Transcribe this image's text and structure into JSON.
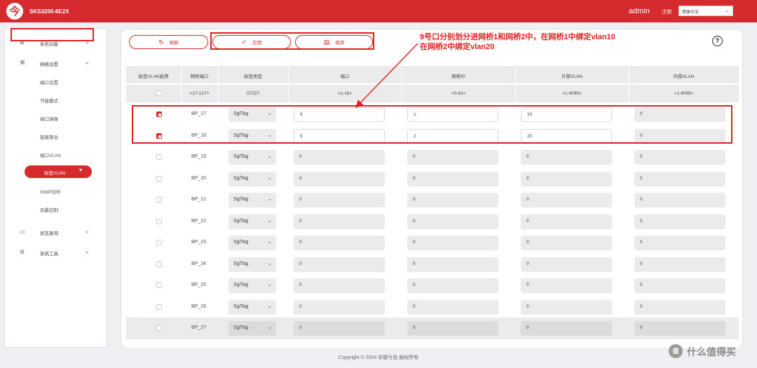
{
  "header": {
    "logo_char": "今",
    "model": "SKS3200-8E2X",
    "user": "admin",
    "logout": "注销",
    "language": "简体中文"
  },
  "sidebar": {
    "groups": [
      {
        "icon": "grid-icon",
        "label": "系统功能"
      },
      {
        "icon": "network-icon",
        "label": "网络设置"
      },
      {
        "icon": "monitor-icon",
        "label": "状态查询"
      },
      {
        "icon": "tools-icon",
        "label": "系统工具"
      }
    ],
    "sub_items": [
      "端口设置",
      "节能模式",
      "端口镜像",
      "链路聚合",
      "端口VLAN",
      "标签VLAN",
      "IGMP侦听",
      "风暴控制"
    ],
    "active_item": "标签VLAN"
  },
  "toolbar": {
    "refresh": "刷新",
    "apply": "应用",
    "save": "保存",
    "help": "?"
  },
  "annotation": {
    "line1": "9号口分别划分进网桥1和网桥2中，在网桥1中绑定vlan10",
    "line2": "在网桥2中绑定vlan20"
  },
  "table": {
    "headers": [
      "标签VLAN启用",
      "网桥端口",
      "标签类型",
      "端口",
      "网桥ID",
      "外部VLAN",
      "内部VLAN"
    ],
    "ranges": [
      "",
      "<17-127>",
      "ST/DT",
      "<1-16>",
      "<0-63>",
      "<1-4095>",
      "<1-4095>"
    ],
    "rows": [
      {
        "enabled": true,
        "port": "BP_17",
        "tag": "SglTag",
        "iface": "9",
        "bridge": "1",
        "outer": "10",
        "inner": "0"
      },
      {
        "enabled": true,
        "port": "BP_18",
        "tag": "SglTag",
        "iface": "9",
        "bridge": "2",
        "outer": "20",
        "inner": "0"
      },
      {
        "enabled": false,
        "port": "BP_19",
        "tag": "SglTag",
        "iface": "0",
        "bridge": "0",
        "outer": "0",
        "inner": "0"
      },
      {
        "enabled": false,
        "port": "BP_20",
        "tag": "SglTag",
        "iface": "0",
        "bridge": "0",
        "outer": "0",
        "inner": "0"
      },
      {
        "enabled": false,
        "port": "BP_21",
        "tag": "SglTag",
        "iface": "0",
        "bridge": "0",
        "outer": "0",
        "inner": "0"
      },
      {
        "enabled": false,
        "port": "BP_22",
        "tag": "SglTag",
        "iface": "0",
        "bridge": "0",
        "outer": "0",
        "inner": "0"
      },
      {
        "enabled": false,
        "port": "BP_23",
        "tag": "SglTag",
        "iface": "0",
        "bridge": "0",
        "outer": "0",
        "inner": "0"
      },
      {
        "enabled": false,
        "port": "BP_24",
        "tag": "SglTag",
        "iface": "0",
        "bridge": "0",
        "outer": "0",
        "inner": "0"
      },
      {
        "enabled": false,
        "port": "BP_25",
        "tag": "SglTag",
        "iface": "0",
        "bridge": "0",
        "outer": "0",
        "inner": "0"
      },
      {
        "enabled": false,
        "port": "BP_26",
        "tag": "SglTag",
        "iface": "0",
        "bridge": "0",
        "outer": "0",
        "inner": "0"
      },
      {
        "enabled": false,
        "port": "BP_27",
        "tag": "SglTag",
        "iface": "0",
        "bridge": "0",
        "outer": "0",
        "inner": "0"
      }
    ]
  },
  "footer": "Copyright © 2024 安徽兮克 版权所有",
  "watermark": "什么值得买",
  "watermark_icon": "值",
  "colors": {
    "brand": "#d52b2e",
    "annotation": "#e02020"
  }
}
